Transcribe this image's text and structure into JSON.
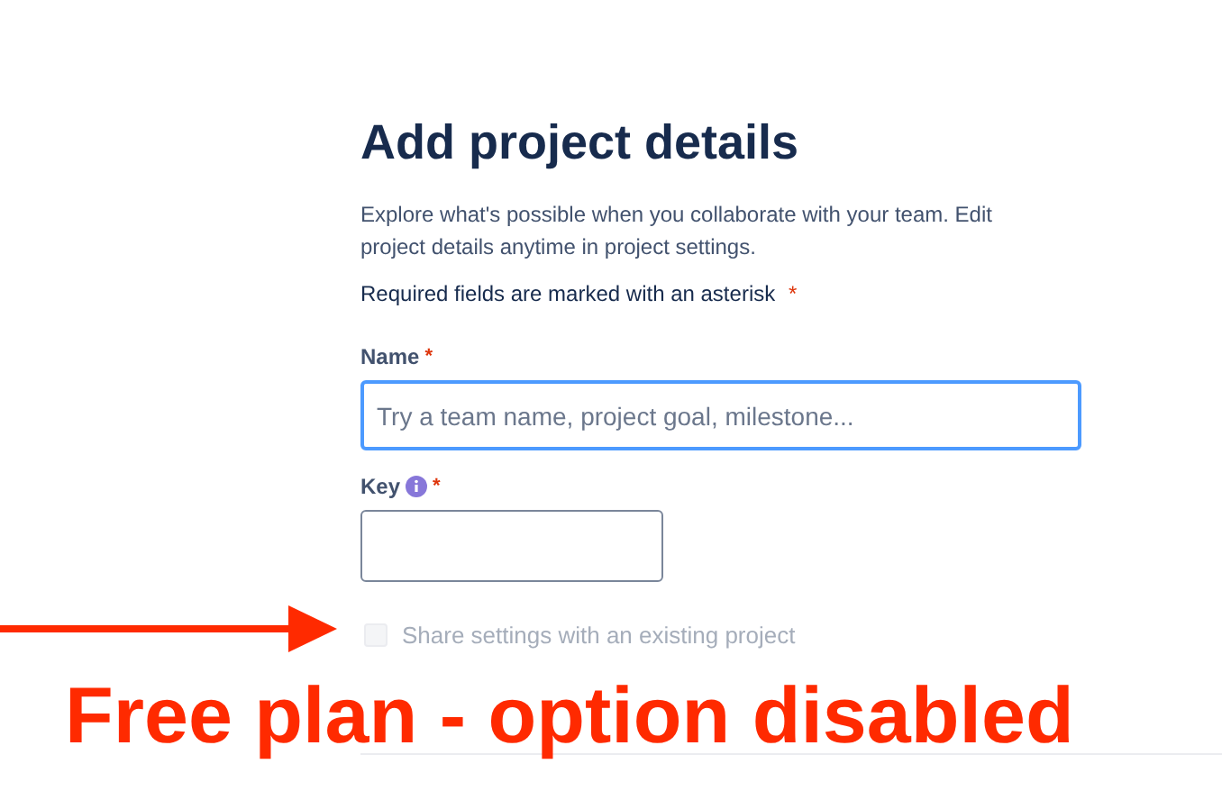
{
  "form": {
    "title": "Add project details",
    "description": "Explore what's possible when you collaborate with your team. Edit project details anytime in project settings.",
    "required_note": "Required fields are marked with an asterisk",
    "required_mark": "*",
    "fields": [
      {
        "label": "Name",
        "required": true,
        "info": false,
        "focused": true,
        "placeholder": "Try a team name, project goal, milestone...",
        "kind": "wide"
      },
      {
        "label": "Key",
        "required": true,
        "info": true,
        "focused": false,
        "kind": "narrow"
      }
    ],
    "share_option": {
      "label": "Share settings with an existing project",
      "checked": false,
      "disabled": true
    }
  },
  "annotation": {
    "text": "Free plan - option disabled"
  }
}
